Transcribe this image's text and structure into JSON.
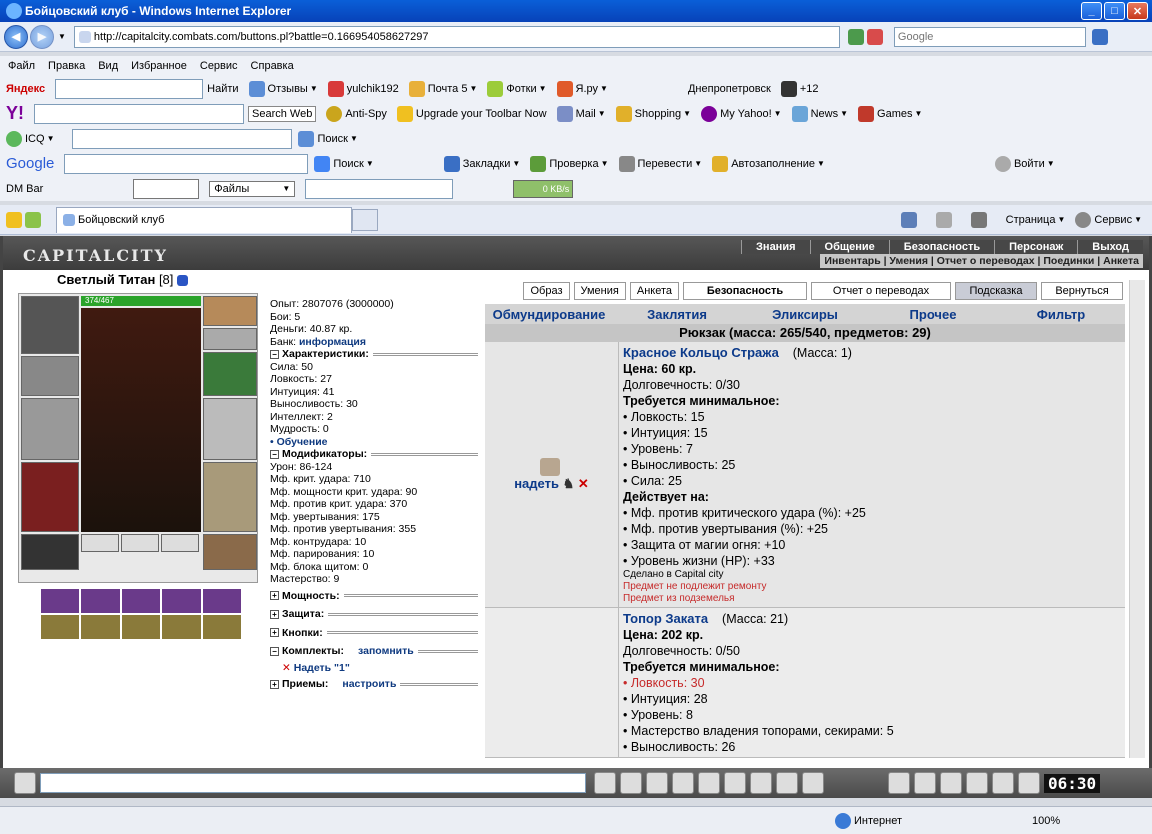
{
  "window": {
    "title": "Бойцовский клуб - Windows Internet Explorer"
  },
  "address": {
    "url": "http://capitalcity.combats.com/buttons.pl?battle=0.166954058627297",
    "search_placeholder": "Google"
  },
  "menu": [
    "Файл",
    "Правка",
    "Вид",
    "Избранное",
    "Сервис",
    "Справка"
  ],
  "yandex": {
    "brand": "Яндекс",
    "find": "Найти",
    "items": [
      "Отзывы",
      "yulchik192",
      "Почта 5",
      "Фотки",
      "Я.ру",
      "Днепропетровск",
      "+12"
    ]
  },
  "yahoo": {
    "brand": "Y!",
    "search_web": "Search Web",
    "items": [
      "Anti-Spy",
      "Upgrade your Toolbar Now",
      "Mail",
      "Shopping",
      "My Yahoo!",
      "News",
      "Games"
    ]
  },
  "icq": {
    "brand": "ICQ",
    "search": "Поиск"
  },
  "google": {
    "brand": "Google",
    "items": [
      "Поиск",
      "Закладки",
      "Проверка",
      "Перевести",
      "Автозаполнение",
      "Войти"
    ]
  },
  "dmbar": {
    "brand": "DM Bar",
    "files": "Файлы",
    "speed": "0 KB/s"
  },
  "tabbar": {
    "tab": "Бойцовский клуб",
    "page": "Страница",
    "service": "Сервис"
  },
  "game": {
    "logo": "CAPITALCITY",
    "nav_top": [
      "Знания",
      "Общение",
      "Безопасность",
      "Персонаж",
      "Выход"
    ],
    "nav_sub": "Инвентарь | Умения | Отчет о переводах | Поединки | Анкета",
    "character": {
      "name": "Светлый Титан",
      "level": "[8]",
      "hp": "374/467"
    },
    "stats": {
      "exp": "Опыт: 2807076 (3000000)",
      "fights": "Бои: 5",
      "money": "Деньги: 40.87 кр.",
      "bank_label": "Банк:",
      "bank_link": "информация",
      "char_section": "Характеристики:",
      "attrs": [
        "Сила: 50",
        "Ловкость: 27",
        "Интуиция: 41",
        "Выносливость: 30",
        "Интеллект: 2",
        "Мудрость: 0"
      ],
      "training": "• Обучение",
      "mod_section": "Модификаторы:",
      "mods": [
        "Урон: 86-124",
        "Мф. крит. удара: 710",
        "Мф. мощности крит. удара: 90",
        "Мф. против крит. удара: 370",
        "Мф. увертывания: 175",
        "Мф. против увертывания: 355",
        "Мф. контрудара: 10",
        "Мф. парирования: 10",
        "Мф. блока щитом: 0",
        "Мастерство: 9"
      ],
      "power": "Мощность:",
      "defense": "Защита:",
      "buttons": "Кнопки:",
      "sets": "Комплекты:",
      "remember": "запомнить",
      "wear_set": "Надеть \"1\"",
      "tricks": "Приемы:",
      "configure": "настроить"
    },
    "buttons": [
      "Образ",
      "Умения",
      "Анкета",
      "Безопасность",
      "Отчет о переводах",
      "Подсказка",
      "Вернуться"
    ],
    "tabs": [
      "Обмундирование",
      "Заклятия",
      "Эликсиры",
      "Прочее",
      "Фильтр"
    ],
    "backpack": "Рюкзак (масса: 265/540, предметов: 29)",
    "wear": "надеть",
    "items": [
      {
        "name": "Красное Кольцо Стража",
        "mass": "(Масса: 1)",
        "price": "Цена: 60 кр.",
        "dur": "Долговечность: 0/30",
        "req_title": "Требуется минимальное:",
        "reqs": [
          "• Ловкость: 15",
          "• Интуиция: 15",
          "• Уровень: 7",
          "• Выносливость: 25",
          "• Сила: 25"
        ],
        "eff_title": "Действует на:",
        "effs": [
          "• Мф. против критического удара (%): +25",
          "• Мф. против увертывания (%): +25",
          "• Защита от магии огня: +10",
          "• Уровень жизни (HP): +33"
        ],
        "made": "Сделано в Capital city",
        "note1": "Предмет не подлежит ремонту",
        "note2": "Предмет из подземелья"
      },
      {
        "name": "Топор Заката",
        "mass": "(Масса: 21)",
        "price": "Цена: 202 кр.",
        "dur": "Долговечность: 0/50",
        "req_title": "Требуется минимальное:",
        "req_red": "• Ловкость: 30",
        "reqs": [
          "• Интуиция: 28",
          "• Уровень: 8",
          "• Мастерство владения топорами, секирами: 5",
          "• Выносливость: 26"
        ]
      }
    ],
    "clock": "06:30"
  },
  "status": {
    "zone": "Интернет",
    "zoom": "100%"
  }
}
